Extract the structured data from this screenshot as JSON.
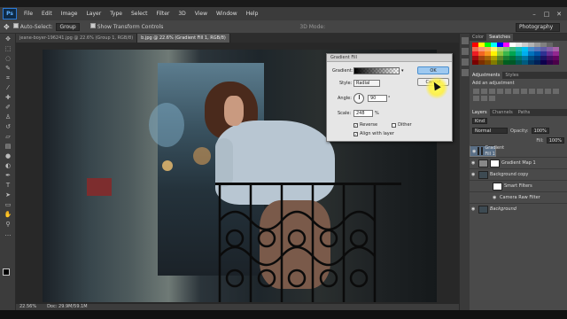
{
  "app": {
    "logo": "Ps"
  },
  "menu": [
    "File",
    "Edit",
    "Image",
    "Layer",
    "Type",
    "Select",
    "Filter",
    "3D",
    "View",
    "Window",
    "Help"
  ],
  "options": {
    "auto_select": "Auto-Select:",
    "group": "Group",
    "transform": "Show Transform Controls",
    "mode": "3D Mode:",
    "workspace": "Photography"
  },
  "tabs": [
    {
      "label": "jeane-boyer-196241.jpg @ 22.6% (Group 1, RGB/8)",
      "active": false
    },
    {
      "label": "b.jpg @ 22.6% (Gradient Fill 1, RGB/8)",
      "active": true
    }
  ],
  "dialog": {
    "title": "Gradient Fill",
    "gradient_label": "Gradient:",
    "style_label": "Style:",
    "style_value": "Radial",
    "angle_label": "Angle:",
    "angle_value": "90",
    "scale_label": "Scale:",
    "scale_value": "248",
    "scale_unit": "%",
    "reverse_label": "Reverse",
    "dither_label": "Dither",
    "align_label": "Align with layer",
    "ok_label": "OK",
    "cancel_label": "Cancel"
  },
  "status": {
    "zoom": "22.56%",
    "doc": "Doc: 29.9M/59.1M"
  },
  "panels": {
    "color_tab": "Color",
    "swatches_tab": "Swatches",
    "adjustments_tab": "Adjustments",
    "styles_tab": "Styles",
    "add_adjustment": "Add an adjustment",
    "layers_tab": "Layers",
    "channels_tab": "Channels",
    "paths_tab": "Paths",
    "kind": "Kind",
    "blend": "Normal",
    "opacity_label": "Opacity:",
    "opacity_value": "100%",
    "fill_label": "Fill:",
    "fill_value": "100%",
    "layers": [
      {
        "name": "Gradient Fill 1",
        "selected": true
      },
      {
        "name": "Gradient Map 1",
        "selected": false
      },
      {
        "name": "Background copy",
        "selected": false
      },
      {
        "name": "Smart Filters",
        "selected": false,
        "sub": true
      },
      {
        "name": "Camera Raw Filter",
        "selected": false,
        "sub": true
      },
      {
        "name": "Background",
        "selected": false
      }
    ]
  },
  "swatch_colors": [
    "#ff0000",
    "#ffff00",
    "#00ff00",
    "#00ffff",
    "#0000ff",
    "#ff00ff",
    "#ffffff",
    "#e6e6e6",
    "#cccccc",
    "#b3b3b3",
    "#999999",
    "#808080",
    "#666666",
    "#4d4d4d",
    "#f26c4f",
    "#f69679",
    "#fbaf5c",
    "#fff467",
    "#acd372",
    "#7cc576",
    "#3bb878",
    "#1abbb4",
    "#00bff3",
    "#438ccb",
    "#5574b9",
    "#605ca8",
    "#855fa8",
    "#a763a8",
    "#ed1c24",
    "#f26522",
    "#f7941d",
    "#fff200",
    "#8dc63f",
    "#39b54a",
    "#00a651",
    "#00a99d",
    "#00aeef",
    "#0072bc",
    "#0054a6",
    "#2e3192",
    "#662d91",
    "#92278f",
    "#9e0b0f",
    "#a0410d",
    "#a36209",
    "#aba000",
    "#598527",
    "#1a7b30",
    "#007236",
    "#00746b",
    "#0076a3",
    "#004b80",
    "#003471",
    "#1b1464",
    "#440e62",
    "#630460",
    "#790000",
    "#7b2e00",
    "#7d4900",
    "#827b00",
    "#406618",
    "#005e20",
    "#005826",
    "#005952",
    "#005b7f",
    "#003663",
    "#002157",
    "#0d004c",
    "#32004b",
    "#4b0049"
  ]
}
